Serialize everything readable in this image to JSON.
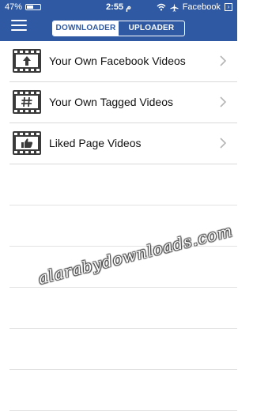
{
  "status_bar": {
    "battery_percent_label": "47%",
    "battery_level": 0.47,
    "time": "2:55",
    "time_suffix": "م",
    "back_app_label": "Facebook"
  },
  "header": {
    "menu_icon": "hamburger-menu-icon",
    "tabs": [
      {
        "label": "DOWNLOADER",
        "active": true
      },
      {
        "label": "UPLOADER",
        "active": false
      }
    ]
  },
  "list": {
    "items": [
      {
        "label": "Your Own Facebook Videos",
        "icon": "upload-arrow-film-icon"
      },
      {
        "label": "Your Own Tagged Videos",
        "icon": "hashtag-film-icon"
      },
      {
        "label": "Liked Page Videos",
        "icon": "thumbs-up-film-icon"
      }
    ]
  },
  "watermark": {
    "text": "alarabydownloads.com"
  },
  "colors": {
    "header_bg": "#2f5aa3",
    "divider": "#d9d9d9"
  }
}
